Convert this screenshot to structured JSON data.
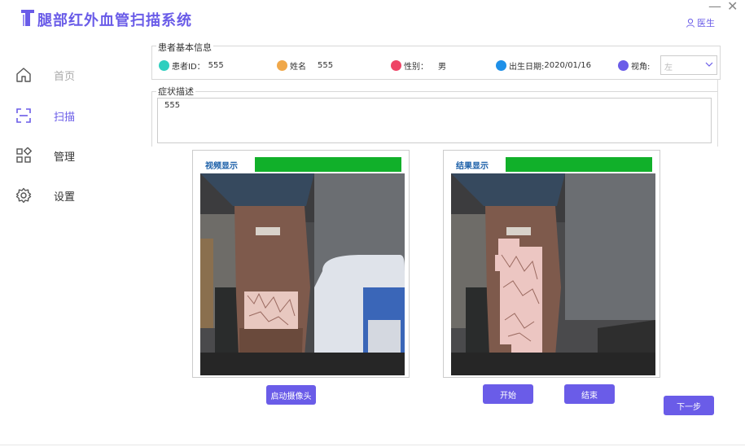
{
  "app": {
    "title": "腿部红外血管扫描系统",
    "user": "医生"
  },
  "window": {
    "minimize": "—",
    "close": "✕"
  },
  "sidebar": {
    "items": [
      {
        "label": "首页",
        "icon": "home-icon"
      },
      {
        "label": "扫描",
        "icon": "scan-icon"
      },
      {
        "label": "管理",
        "icon": "apps-icon"
      },
      {
        "label": "设置",
        "icon": "gear-icon"
      }
    ]
  },
  "patient": {
    "legend": "患者基本信息",
    "id_label": "患者ID：",
    "id_value": "555",
    "name_label": "姓名",
    "name_value": "555",
    "gender_label": "性别：",
    "gender_value": "男",
    "birth_label": "出生日期:",
    "birth_value": "2020/01/16",
    "view_label": "视角:",
    "view_value": "左"
  },
  "colors": {
    "id": "#2fcfbf",
    "name": "#f0a84a",
    "gender": "#ee4466",
    "birth": "#1e90e8",
    "view": "#6a5ce8",
    "accent": "#6a5ce8",
    "bar": "#11b02a"
  },
  "symptom": {
    "legend": "症状描述",
    "value": "555"
  },
  "video": {
    "title": "视频显示"
  },
  "result": {
    "title": "结果显示"
  },
  "buttons": {
    "camera": "启动摄像头",
    "start": "开始",
    "end": "结束",
    "next": "下一步"
  }
}
